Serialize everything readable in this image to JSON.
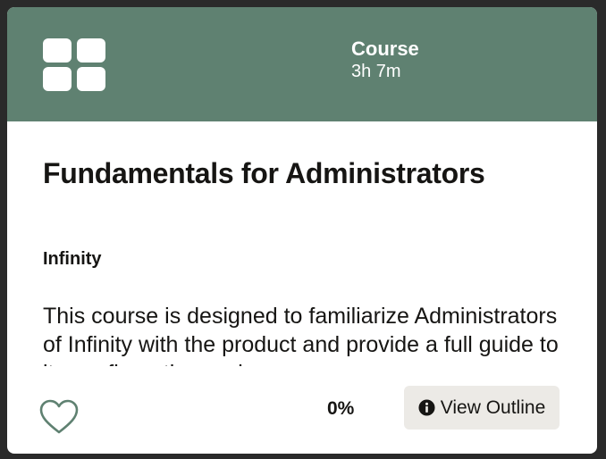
{
  "course": {
    "type_label": "Course",
    "duration": "3h 7m",
    "title": "Fundamentals for Administrators",
    "provider": "Infinity",
    "description": "This course is designed to familiarize Administrators of Infinity with the product and provide a full guide to its configuration and use."
  },
  "footer": {
    "progress": "0%",
    "progress_value": 0,
    "view_outline_label": "View Outline"
  },
  "icons": {
    "header": "grid-icon",
    "favorite": "heart-outline-icon",
    "outline": "info-circle-icon"
  },
  "colors": {
    "header_bg": "#5f8171",
    "accent_green": "#5f8171",
    "button_bg": "#eceae6",
    "text": "#161513"
  }
}
